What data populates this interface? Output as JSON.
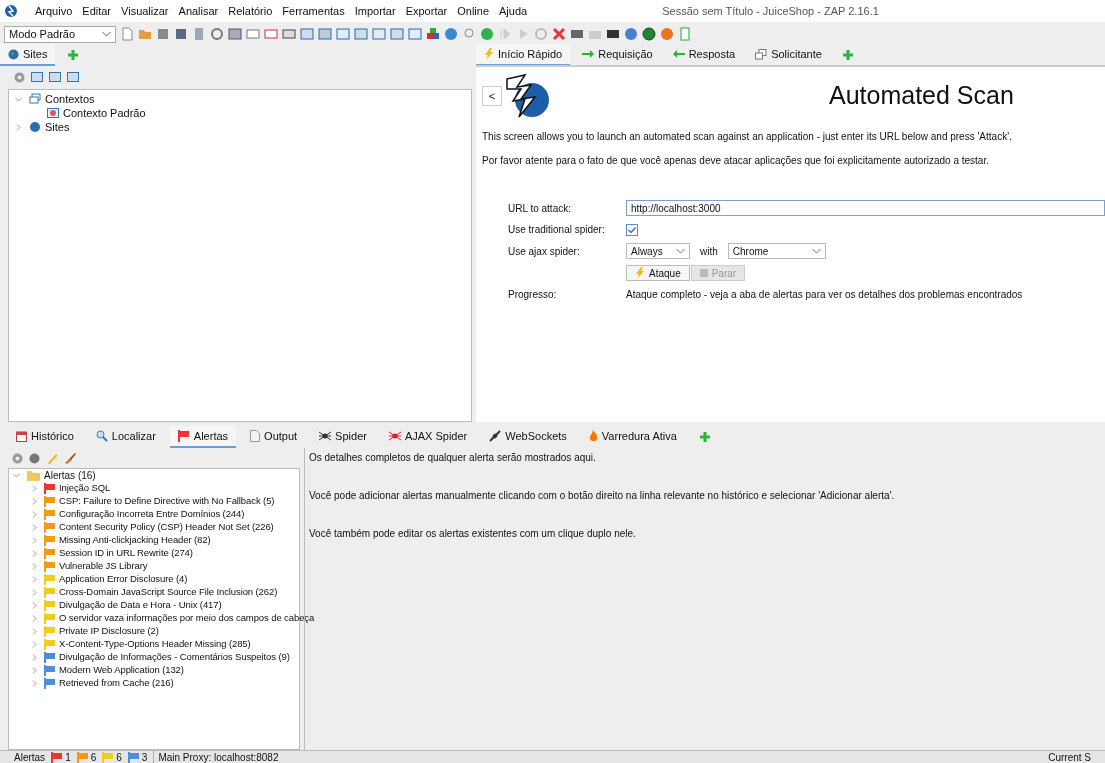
{
  "menu": [
    "Arquivo",
    "Editar",
    "Visualizar",
    "Analisar",
    "Relatório",
    "Ferramentas",
    "Importar",
    "Exportar",
    "Online",
    "Ajuda"
  ],
  "window": {
    "title": "Sessão sem Título - JuiceShop - ZAP 2.16.1"
  },
  "mode_select": {
    "value": "Modo Padrão"
  },
  "left_tabs": [
    {
      "label": "Sites",
      "selected": true
    }
  ],
  "tree": [
    {
      "label": "Contextos",
      "expanded": true,
      "children": [
        {
          "label": "Contexto Padrão"
        }
      ]
    },
    {
      "label": "Sites",
      "expanded": false
    }
  ],
  "right_tabs": [
    {
      "label": "Início Rápido",
      "selected": true
    },
    {
      "label": "Requisição",
      "selected": false
    },
    {
      "label": "Resposta",
      "selected": false
    },
    {
      "label": "Solicitante",
      "selected": false
    }
  ],
  "quick_start": {
    "back": "<",
    "title": "Automated Scan",
    "intro": "This screen allows you to launch an automated scan against  an application - just enter its URL below and press 'Attack'.",
    "warning": "Por favor atente para o fato de que você apenas deve atacar aplicações que foi explicitamente autorizado a testar.",
    "url_label": "URL to attack:",
    "url": "http://localhost:3000",
    "spider_label": "Use traditional spider:",
    "spider_checked": true,
    "ajax_label": "Use ajax spider:",
    "ajax_value": "Always",
    "with": "with",
    "browser": "Chrome",
    "attack": "Ataque",
    "stop": "Parar",
    "stop_disabled": true,
    "progress_label": "Progresso:",
    "progress": "Ataque completo - veja a aba de alertas para ver os detalhes dos problemas encontrados"
  },
  "bottom_tabs": [
    {
      "label": "Histórico",
      "selected": false
    },
    {
      "label": "Localizar",
      "selected": false
    },
    {
      "label": "Alertas",
      "selected": true
    },
    {
      "label": "Output",
      "selected": false
    },
    {
      "label": "Spider",
      "selected": false
    },
    {
      "label": "AJAX Spider",
      "selected": false
    },
    {
      "label": "WebSockets",
      "selected": false
    },
    {
      "label": "Varredura Ativa",
      "selected": false
    }
  ],
  "alerts": {
    "label": "Alertas (16)",
    "expanded": true,
    "children": [
      {
        "label": "Injeção SQL",
        "color": "#e8392f"
      },
      {
        "label": "CSP: Failure to Define Directive with No Fallback (5)",
        "color": "#f29b11"
      },
      {
        "label": "Configuração Incorreta Entre Domínios (244)",
        "color": "#f29b11"
      },
      {
        "label": "Content Security Policy (CSP) Header Not Set (226)",
        "color": "#f29b11"
      },
      {
        "label": "Missing Anti-clickjacking Header (82)",
        "color": "#f29b11"
      },
      {
        "label": "Session ID in URL Rewrite (274)",
        "color": "#f29b11"
      },
      {
        "label": "Vulnerable JS Library",
        "color": "#f29b11"
      },
      {
        "label": "Application Error Disclosure (4)",
        "color": "#f2cc1c"
      },
      {
        "label": "Cross-Domain JavaScript Source File Inclusion (262)",
        "color": "#f2cc1c"
      },
      {
        "label": "Divulgação de Data e Hora - Unix (417)",
        "color": "#f2cc1c"
      },
      {
        "label": "O servidor vaza informações por meio dos campos de cabeça",
        "color": "#f2cc1c"
      },
      {
        "label": "Private IP Disclosure (2)",
        "color": "#f2cc1c"
      },
      {
        "label": "X-Content-Type-Options Header Missing (285)",
        "color": "#f2cc1c"
      },
      {
        "label": "Divulgação de Informações - Comentários Suspeitos (9)",
        "color": "#4a8fd9"
      },
      {
        "label": "Modern Web Application (132)",
        "color": "#4a8fd9"
      },
      {
        "label": "Retrieved from Cache (216)",
        "color": "#4a8fd9"
      }
    ]
  },
  "details": [
    "Os detalhes completos de qualquer alerta serão mostrados aqui.",
    "Você pode adicionar alertas manualmente clicando com o botão direito na linha relevante no histórico e selecionar 'Adicionar alerta'.",
    "Você também pode editar os alertas existentes com um clique duplo nele."
  ],
  "status_bar": {
    "label": "Alertas",
    "counts": [
      {
        "count": "1",
        "color": "#e8392f"
      },
      {
        "count": "6",
        "color": "#f29b11"
      },
      {
        "count": "6",
        "color": "#f2cc1c"
      },
      {
        "count": "3",
        "color": "#4a8fd9"
      }
    ],
    "proxy": "Main Proxy: localhost:8082",
    "right": "Current S"
  }
}
